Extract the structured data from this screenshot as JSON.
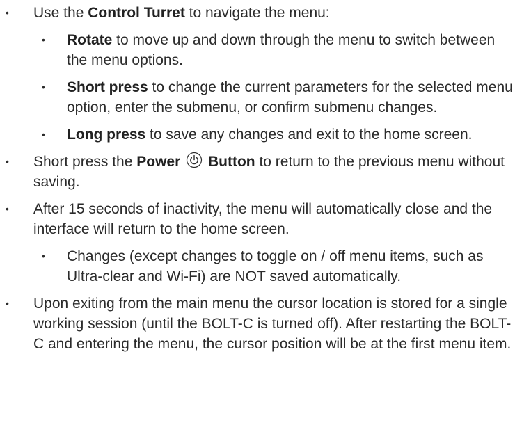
{
  "items": [
    {
      "pre": "Use the ",
      "bold": "Control Turret",
      "post": " to navigate the menu:",
      "subitems": [
        {
          "bold": "Rotate",
          "text": " to move up and down through the menu to switch between the menu options."
        },
        {
          "bold": "Short press",
          "text": " to change the current parameters for the selected menu option, enter the submenu, or confirm submenu changes."
        },
        {
          "bold": "Long press",
          "text": " to save any changes and exit to the home screen."
        }
      ]
    },
    {
      "pre": "Short press the ",
      "bold1": "Power",
      "icon": "power-icon",
      "bold2": "Button",
      "post": " to return to the previous menu without saving."
    },
    {
      "text": "After 15 seconds of inactivity, the menu will automatically close and the interface will return to the home screen.",
      "subitems": [
        {
          "text": "Changes (except changes to toggle on / off menu items, such as Ultra-clear and Wi-Fi) are NOT saved automatically."
        }
      ]
    },
    {
      "text": "Upon exiting from the main menu the cursor location is stored for a single working session (until the BOLT-C is turned off). After restarting the BOLT-C and entering the menu, the cursor position will be at the first menu item."
    }
  ]
}
